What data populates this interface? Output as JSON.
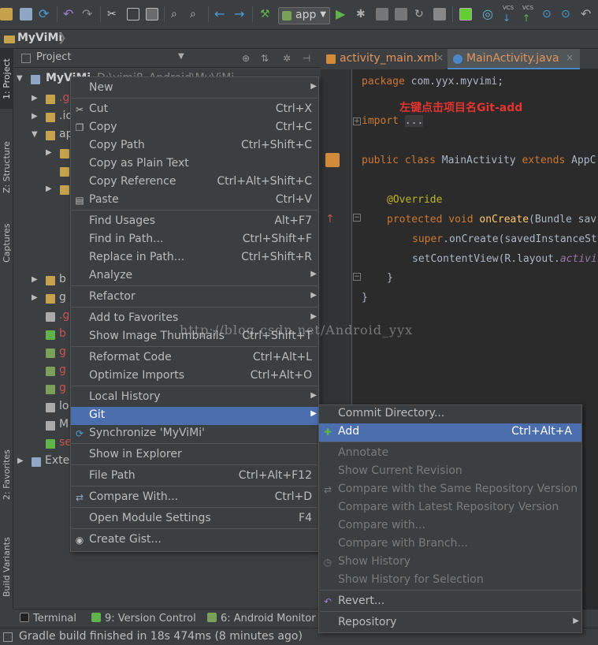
{
  "toolbar": {
    "run_config": "app",
    "vcs_label_1": "VCS",
    "vcs_label_2": "VCS"
  },
  "breadcrumb": {
    "project": "MyViMi"
  },
  "left_tool_windows": [
    "1: Project",
    "Z: Structure",
    "Captures",
    "2: Favorites",
    "Build Variants"
  ],
  "project_panel": {
    "title": "Project",
    "root_label": "MyViMi",
    "root_path": "D:\\vimi8_Android\\MyViMi",
    "tree_rows": [
      {
        "label": ".g",
        "color": "#c75450"
      },
      {
        "label": ".ic",
        "color": "#bbbbbb"
      },
      {
        "label": "ap",
        "color": "#bbbbbb"
      },
      {
        "label": "",
        "color": "#bbbbbb"
      },
      {
        "label": "",
        "color": "#bbbbbb"
      },
      {
        "label": "",
        "color": "#bbbbbb"
      },
      {
        "label": "",
        "color": "#bbbbbb"
      },
      {
        "label": "",
        "color": "#bbbbbb"
      },
      {
        "label": "",
        "color": "#bbbbbb"
      },
      {
        "label": "",
        "color": "#bbbbbb"
      },
      {
        "label": "b",
        "color": "#bbbbbb"
      },
      {
        "label": "g",
        "color": "#bbbbbb"
      },
      {
        "label": ".g",
        "color": "#c75450"
      },
      {
        "label": "b",
        "color": "#c75450"
      },
      {
        "label": "g",
        "color": "#c75450"
      },
      {
        "label": "g",
        "color": "#c75450"
      },
      {
        "label": "g",
        "color": "#c75450"
      },
      {
        "label": "lo",
        "color": "#bbbbbb"
      },
      {
        "label": "M",
        "color": "#bbbbbb"
      },
      {
        "label": "se",
        "color": "#c75450"
      },
      {
        "label": "Exter",
        "color": "#bbbbbb"
      }
    ]
  },
  "editor": {
    "tabs": [
      {
        "label": "activity_main.xml",
        "close": "×"
      },
      {
        "label": "MainActivity.java",
        "close": "×"
      }
    ],
    "annotation": "左键点击项目名Git-add",
    "watermark": "http://blog.csdn.net/Android_yyx"
  },
  "context_menu": {
    "items": [
      {
        "label": "New",
        "shortcut": "",
        "submenu": true,
        "icon": ""
      },
      {
        "label": "Cut",
        "shortcut": "Ctrl+X",
        "submenu": false,
        "icon": "scissors-icon"
      },
      {
        "label": "Copy",
        "shortcut": "Ctrl+C",
        "submenu": false,
        "icon": "copy-icon"
      },
      {
        "label": "Copy Path",
        "shortcut": "Ctrl+Shift+C",
        "submenu": false,
        "icon": ""
      },
      {
        "label": "Copy as Plain Text",
        "shortcut": "",
        "submenu": false,
        "icon": ""
      },
      {
        "label": "Copy Reference",
        "shortcut": "Ctrl+Alt+Shift+C",
        "submenu": false,
        "icon": ""
      },
      {
        "label": "Paste",
        "shortcut": "Ctrl+V",
        "submenu": false,
        "icon": "paste-icon"
      },
      {
        "label": "Find Usages",
        "shortcut": "Alt+F7",
        "submenu": false,
        "icon": ""
      },
      {
        "label": "Find in Path...",
        "shortcut": "Ctrl+Shift+F",
        "submenu": false,
        "icon": ""
      },
      {
        "label": "Replace in Path...",
        "shortcut": "Ctrl+Shift+R",
        "submenu": false,
        "icon": ""
      },
      {
        "label": "Analyze",
        "shortcut": "",
        "submenu": true,
        "icon": ""
      },
      {
        "label": "Refactor",
        "shortcut": "",
        "submenu": true,
        "icon": ""
      },
      {
        "label": "Add to Favorites",
        "shortcut": "",
        "submenu": true,
        "icon": ""
      },
      {
        "label": "Show Image Thumbnails",
        "shortcut": "Ctrl+Shift+T",
        "submenu": false,
        "icon": ""
      },
      {
        "label": "Reformat Code",
        "shortcut": "Ctrl+Alt+L",
        "submenu": false,
        "icon": ""
      },
      {
        "label": "Optimize Imports",
        "shortcut": "Ctrl+Alt+O",
        "submenu": false,
        "icon": ""
      },
      {
        "label": "Local History",
        "shortcut": "",
        "submenu": true,
        "icon": ""
      },
      {
        "label": "Git",
        "shortcut": "",
        "submenu": true,
        "icon": ""
      },
      {
        "label": "Synchronize 'MyViMi'",
        "shortcut": "",
        "submenu": false,
        "icon": "sync-icon"
      },
      {
        "label": "Show in Explorer",
        "shortcut": "",
        "submenu": false,
        "icon": ""
      },
      {
        "label": "File Path",
        "shortcut": "Ctrl+Alt+F12",
        "submenu": false,
        "icon": ""
      },
      {
        "label": "Compare With...",
        "shortcut": "Ctrl+D",
        "submenu": false,
        "icon": "compare-icon"
      },
      {
        "label": "Open Module Settings",
        "shortcut": "F4",
        "submenu": false,
        "icon": ""
      },
      {
        "label": "Create Gist...",
        "shortcut": "",
        "submenu": false,
        "icon": "github-icon"
      }
    ]
  },
  "git_submenu": {
    "items": [
      {
        "label": "Commit Directory...",
        "shortcut": "",
        "submenu": false,
        "disabled": false,
        "icon": ""
      },
      {
        "label": "Add",
        "shortcut": "Ctrl+Alt+A",
        "submenu": false,
        "disabled": false,
        "icon": "add-icon"
      },
      {
        "label": "Annotate",
        "shortcut": "",
        "submenu": false,
        "disabled": true,
        "icon": ""
      },
      {
        "label": "Show Current Revision",
        "shortcut": "",
        "submenu": false,
        "disabled": true,
        "icon": ""
      },
      {
        "label": "Compare with the Same Repository Version",
        "shortcut": "",
        "submenu": false,
        "disabled": true,
        "icon": "compare-icon"
      },
      {
        "label": "Compare with Latest Repository Version",
        "shortcut": "",
        "submenu": false,
        "disabled": true,
        "icon": ""
      },
      {
        "label": "Compare with...",
        "shortcut": "",
        "submenu": false,
        "disabled": true,
        "icon": ""
      },
      {
        "label": "Compare with Branch...",
        "shortcut": "",
        "submenu": false,
        "disabled": true,
        "icon": ""
      },
      {
        "label": "Show History",
        "shortcut": "",
        "submenu": false,
        "disabled": true,
        "icon": "history-icon"
      },
      {
        "label": "Show History for Selection",
        "shortcut": "",
        "submenu": false,
        "disabled": true,
        "icon": ""
      },
      {
        "label": "Revert...",
        "shortcut": "",
        "submenu": false,
        "disabled": false,
        "icon": "revert-icon"
      },
      {
        "label": "Repository",
        "shortcut": "",
        "submenu": true,
        "disabled": false,
        "icon": ""
      }
    ]
  },
  "bottom_tabs": [
    "Terminal",
    "9: Version Control",
    "6: Android Monitor"
  ],
  "status_bar": {
    "message": "Gradle build finished in 18s 474ms (8 minutes ago)"
  },
  "colors": {
    "background": "#3c3f41",
    "editor_bg": "#2b2b2b",
    "selection": "#4b6eaf",
    "annotation_red": "#e5332e",
    "modified_file": "#e2935e"
  }
}
